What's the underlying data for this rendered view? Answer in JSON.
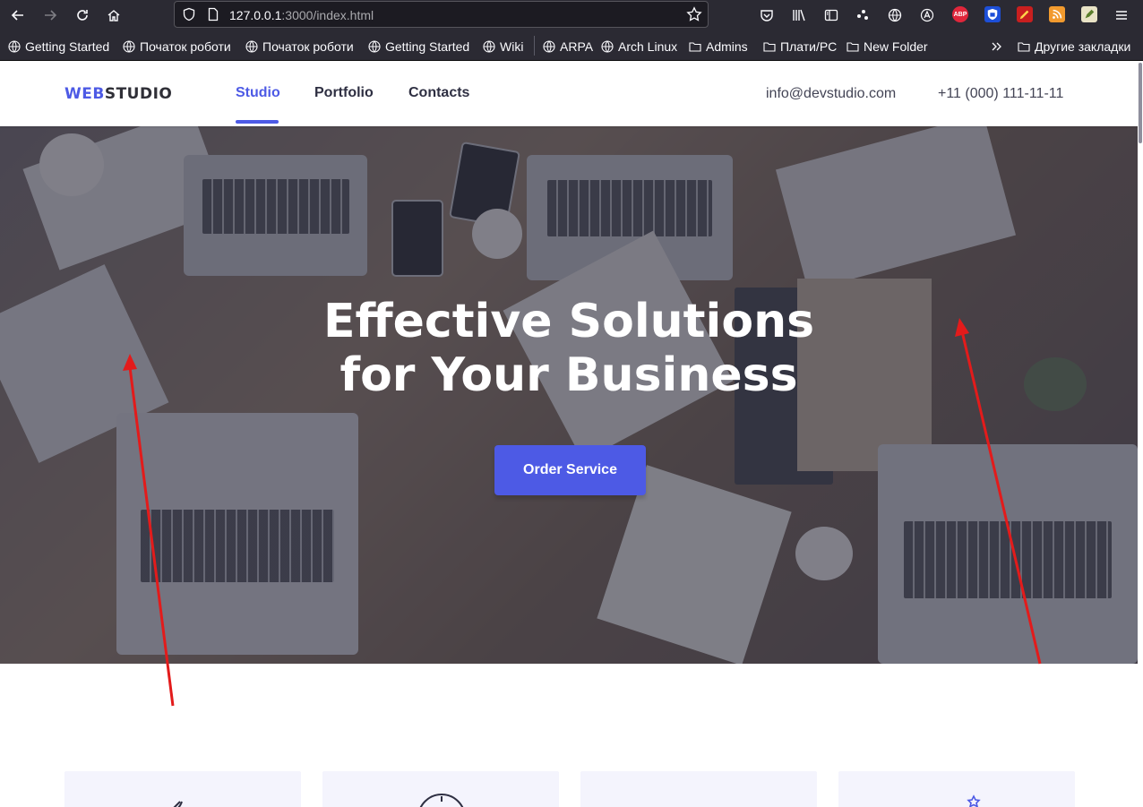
{
  "browser": {
    "url_host": "127.0.0.1",
    "url_rest": ":3000/index.html",
    "bookmarks": [
      {
        "label": "Getting Started",
        "icon": "globe-icon"
      },
      {
        "label": "Початок роботи",
        "icon": "globe-icon"
      },
      {
        "label": "Початок роботи",
        "icon": "globe-icon"
      },
      {
        "label": "Getting Started",
        "icon": "globe-icon"
      },
      {
        "label": "Wiki",
        "icon": "globe-icon"
      },
      {
        "label": "ARPA",
        "icon": "globe-icon"
      },
      {
        "label": "Arch Linux",
        "icon": "globe-icon"
      },
      {
        "label": "Admins",
        "icon": "folder-icon"
      },
      {
        "label": "Плати/PC",
        "icon": "folder-icon"
      },
      {
        "label": "New Folder",
        "icon": "folder-icon"
      }
    ],
    "other_bookmarks": "Другие закладки",
    "extensions": {
      "abp": "ABP"
    }
  },
  "site": {
    "logo_part1": "WEB",
    "logo_part2": "STUDIO",
    "nav": [
      "Studio",
      "Portfolio",
      "Contacts"
    ],
    "active_nav": "Studio",
    "email": "info@devstudio.com",
    "phone": "+11 (000) 111-11-11"
  },
  "hero": {
    "title_line1": "Effective Solutions",
    "title_line2": "for Your Business",
    "button": "Order Service"
  },
  "colors": {
    "accent": "#4d5ae5",
    "dark_text": "#2e2f42",
    "annotation_arrow": "#e31b1b"
  }
}
